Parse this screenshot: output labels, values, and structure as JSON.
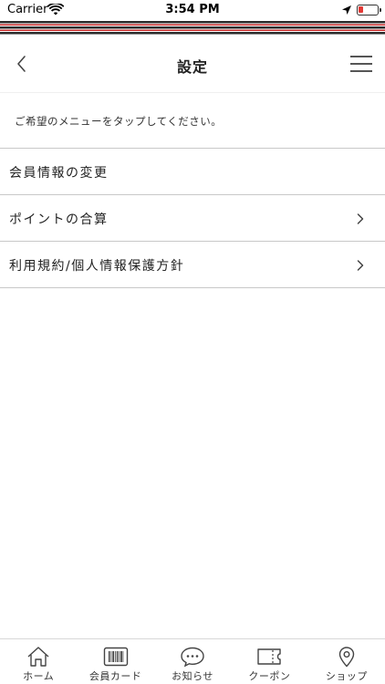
{
  "status_bar": {
    "carrier": "Carrier",
    "time": "3:54 PM"
  },
  "header": {
    "title": "設定"
  },
  "instruction": "ご希望のメニューをタップしてください。",
  "menu": {
    "items": [
      {
        "label": "会員情報の変更",
        "has_chevron": false
      },
      {
        "label": "ポイントの合算",
        "has_chevron": true
      },
      {
        "label": "利用規約/個人情報保護方針",
        "has_chevron": true
      }
    ]
  },
  "tab_bar": {
    "tabs": [
      {
        "label": "ホーム",
        "icon": "home-icon"
      },
      {
        "label": "会員カード",
        "icon": "barcode-icon"
      },
      {
        "label": "お知らせ",
        "icon": "chat-bubble-icon"
      },
      {
        "label": "クーポン",
        "icon": "coupon-icon"
      },
      {
        "label": "ショップ",
        "icon": "map-pin-icon"
      }
    ]
  },
  "colors": {
    "stripe_dark": "#2b2b2b",
    "stripe_red": "#c62828",
    "stripe_white": "#ffffff",
    "divider": "#c8c8c8",
    "battery_low": "#e53935"
  }
}
